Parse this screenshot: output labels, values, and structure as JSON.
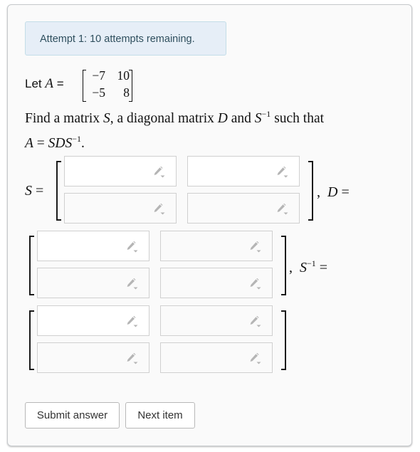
{
  "attempt_banner": "Attempt 1: 10 attempts remaining.",
  "problem": {
    "let_prefix": "Let",
    "var_a": "A",
    "equals": "=",
    "matrix_a": [
      [
        "−7",
        "10"
      ],
      [
        "−5",
        "8"
      ]
    ],
    "find_text_1": "Find a matrix ",
    "var_s": "S",
    "find_text_2": ", a diagonal matrix ",
    "var_d": "D",
    "find_text_3": " and ",
    "inverse_sup": "−1",
    "find_text_4": " such that",
    "equation_lhs": "A",
    "equation_eq": " = ",
    "equation_rhs": "SDS",
    "equation_end": "."
  },
  "answer_labels": {
    "s_label": "S",
    "s_equals": " =",
    "d_sep": ",",
    "d_label": "D",
    "d_equals": " =",
    "sinv_sep": ",",
    "sinv_label": "S",
    "sinv_sup": "−1",
    "sinv_equals": " ="
  },
  "inputs": {
    "s": [
      "",
      "",
      "",
      ""
    ],
    "d": [
      "",
      "",
      "",
      ""
    ],
    "s_inv": [
      "",
      "",
      "",
      ""
    ],
    "icon": "pencil-dropdown-icon"
  },
  "buttons": {
    "submit": "Submit answer",
    "next": "Next item"
  }
}
